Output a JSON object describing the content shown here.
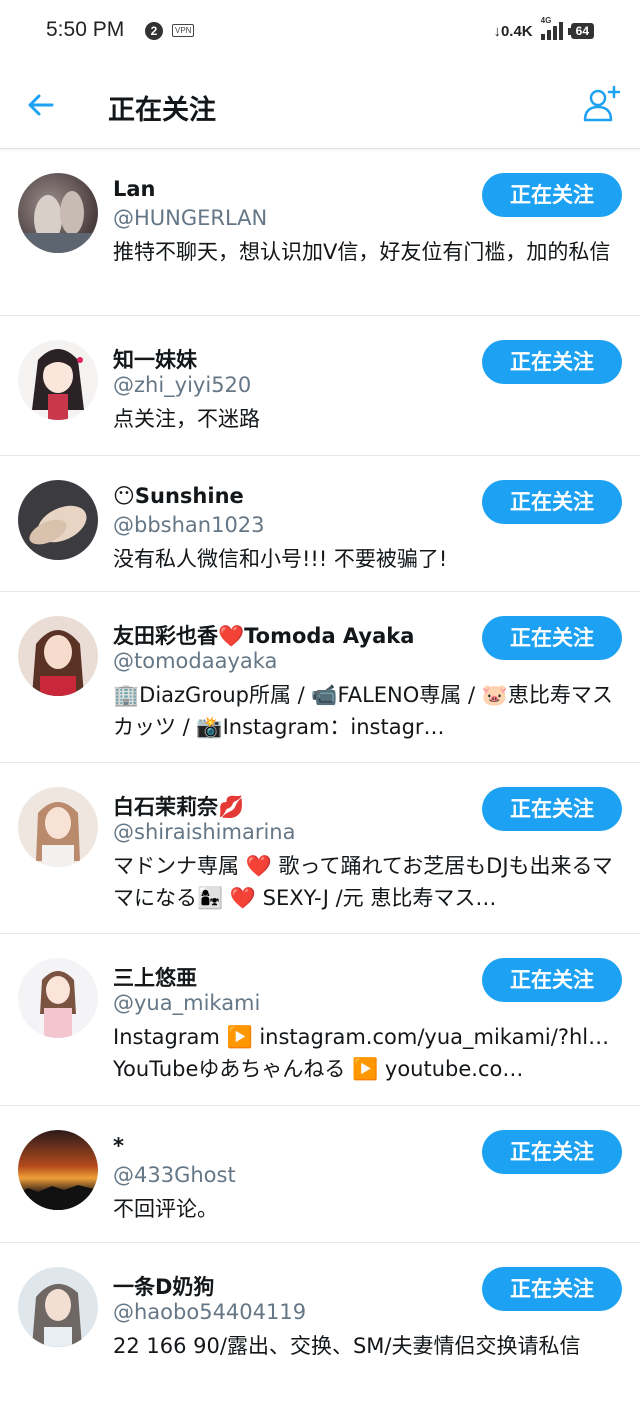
{
  "status_bar": {
    "time": "5:50 PM",
    "notification_count": "2",
    "vpn_label": "VPN",
    "net_speed": "0.4K",
    "network_type": "4G",
    "battery": "64"
  },
  "header": {
    "title": "正在关注",
    "back_icon": "arrow-left-icon",
    "add_icon": "add-user-icon"
  },
  "colors": {
    "accent": "#1da1f2",
    "handle": "#657786",
    "divider": "#e1e8ed"
  },
  "follow_label": "正在关注",
  "users": [
    {
      "name": "Lan",
      "handle": "@HUNGERLAN",
      "bio": "推特不聊天，想认识加V信，好友位有门槛，加的私信"
    },
    {
      "name": "知一妹妹",
      "handle": "@zhi_yiyi520",
      "bio": "点关注，不迷路"
    },
    {
      "name": "😶Sunshine",
      "handle": "@bbshan1023",
      "bio": "没有私人微信和小号!!!  不要被骗了!"
    },
    {
      "name": "友田彩也香❤️Tomoda Ayaka",
      "handle": "@tomodaayaka",
      "bio": "🏢DiazGroup所属 / 📹FALENO専属 / 🐷恵比寿マスカッツ / 📸Instagram：instagr…"
    },
    {
      "name": "白石茉莉奈💋",
      "handle": "@shiraishimarina",
      "bio": "マドンナ専属 ❤️ 歌って踊れてお芝居もDJも出来るママになる👩‍👧 ❤️ SEXY-J /元 恵比寿マス…"
    },
    {
      "name": "三上悠亜",
      "handle": "@yua_mikami",
      "bio": "Instagram ▶️ instagram.com/yua_mikami/?hl… YouTubeゆあちゃんねる ▶️ youtube.co…"
    },
    {
      "name": "*",
      "handle": "@433Ghost",
      "bio": "不回评论。"
    },
    {
      "name": "一条D奶狗",
      "handle": "@haobo54404119",
      "bio": "22 166 90/露出、交换、SM/夫妻情侣交换请私信"
    }
  ]
}
